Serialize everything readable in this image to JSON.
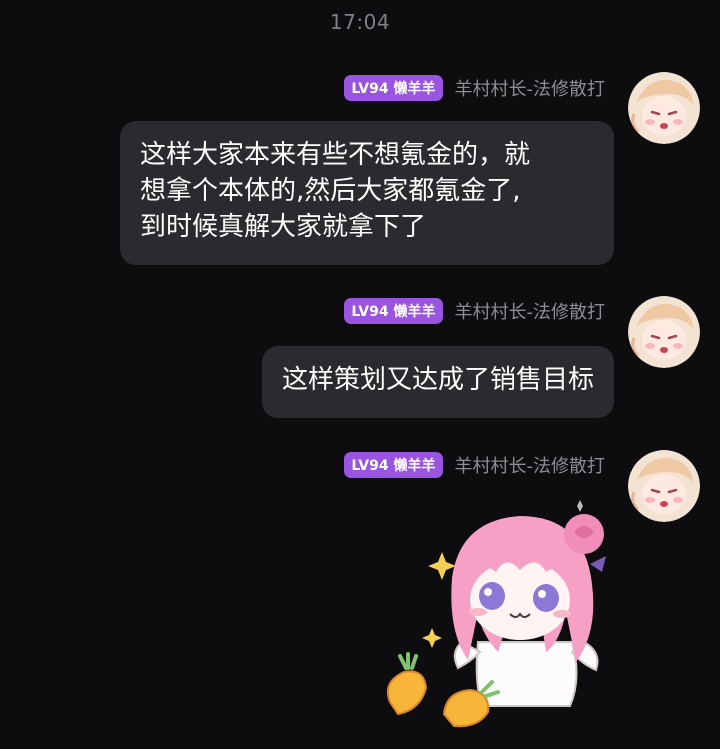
{
  "status": {
    "time": "17:04"
  },
  "messages": [
    {
      "badge": "LV94 懒羊羊",
      "sender": "羊村村长-法修散打",
      "type": "text",
      "lines": [
        "这样大家本来有些不想氪金的，就",
        "想拿个本体的,然后大家都氪金了,",
        "到时候真解大家就拿下了"
      ]
    },
    {
      "badge": "LV94 懒羊羊",
      "sender": "羊村村长-法修散打",
      "type": "text",
      "lines": [
        "这样策划又达成了销售目标"
      ]
    },
    {
      "badge": "LV94 懒羊羊",
      "sender": "羊村村长-法修散打",
      "type": "sticker",
      "sticker_icon": "pink-haired-anime-girl-sticker"
    }
  ],
  "colors": {
    "background": "#0d0c0f",
    "bubble": "#2b2a2f",
    "badge": "#9a55e0",
    "sender_text": "#8d8c93"
  }
}
